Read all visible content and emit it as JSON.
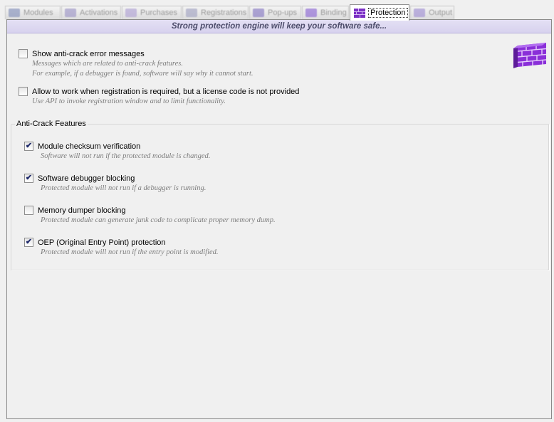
{
  "tabs": [
    {
      "label": "Modules",
      "icon": "modules-icon",
      "color": "#6b7aa8"
    },
    {
      "label": "Activations",
      "icon": "activations-icon",
      "color": "#8a7fb8"
    },
    {
      "label": "Purchases",
      "icon": "purchases-icon",
      "color": "#9b8cc7"
    },
    {
      "label": "Registrations",
      "icon": "registrations-icon",
      "color": "#8d8fb0"
    },
    {
      "label": "Pop-ups",
      "icon": "popups-icon",
      "color": "#7a6bb5"
    },
    {
      "label": "Binding",
      "icon": "binding-icon",
      "color": "#7b56c7"
    },
    {
      "label": "Protection",
      "icon": "brick-wall-icon",
      "color": "#8a3fd1",
      "active": true
    },
    {
      "label": "Output",
      "icon": "output-icon",
      "color": "#8c7ec9"
    }
  ],
  "banner": "Strong protection engine will keep your software safe...",
  "options": {
    "show_errors": {
      "label": "Show anti-crack error messages",
      "desc1": "Messages which are related to anti-crack features.",
      "desc2": "For example, if a debugger is found, software will say why it cannot start.",
      "checked": false
    },
    "allow_no_license": {
      "label": "Allow to work when registration is required, but a license code is not provided",
      "desc1": "Use API to invoke registration window and to limit functionality.",
      "checked": false
    }
  },
  "anticrack": {
    "title": "Anti-Crack Features",
    "items": [
      {
        "label": "Module checksum verification",
        "desc": "Software will not run if the protected module is changed.",
        "checked": true
      },
      {
        "label": "Software debugger blocking",
        "desc": "Protected module will not run if a debugger is running.",
        "checked": true
      },
      {
        "label": "Memory dumper blocking",
        "desc": "Protected module can generate junk code to complicate proper memory dump.",
        "checked": false
      },
      {
        "label": "OEP (Original Entry Point) protection",
        "desc": "Protected module will not run if the entry point is modified.",
        "checked": true
      }
    ]
  },
  "colors": {
    "accent": "#8a3fd1",
    "banner_bg": "#dcd8f0",
    "banner_text": "#4d4d6b"
  },
  "check_glyph": "✔"
}
